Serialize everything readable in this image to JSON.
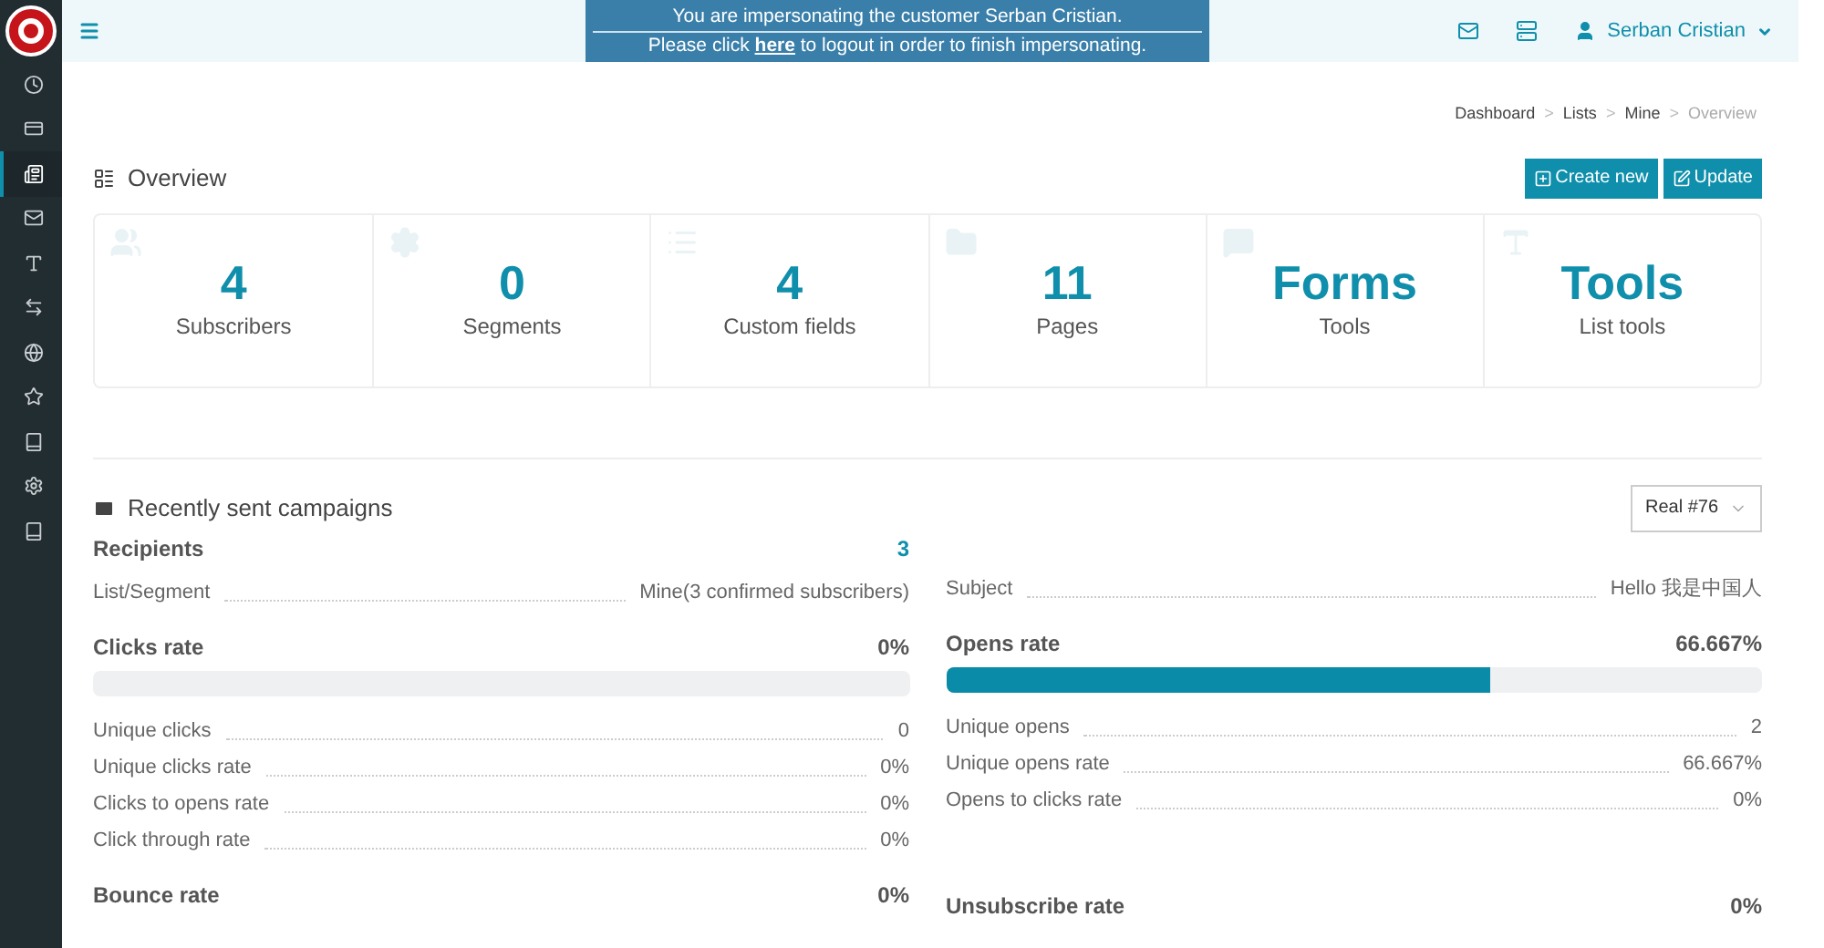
{
  "sidebar": {
    "items": [
      {
        "selected": false
      },
      {
        "selected": false
      },
      {
        "selected": true
      },
      {
        "selected": false
      },
      {
        "selected": false
      },
      {
        "selected": false
      },
      {
        "selected": false
      },
      {
        "selected": false
      },
      {
        "selected": false
      },
      {
        "selected": false
      },
      {
        "selected": false
      }
    ]
  },
  "impersonation": {
    "line1": "You are impersonating the customer Serban Cristian.",
    "before": "Please click ",
    "link": "here",
    "after": " to logout in order to finish impersonating."
  },
  "user": {
    "name": "Serban Cristian"
  },
  "breadcrumb_separator": ">",
  "breadcrumb": [
    {
      "label": "Dashboard",
      "selected": false
    },
    {
      "label": "Lists",
      "selected": false
    },
    {
      "label": "Mine",
      "selected": false
    },
    {
      "label": "Overview",
      "selected": true
    }
  ],
  "overview": {
    "title": "Overview",
    "buttons": [
      {
        "label": "Create new"
      },
      {
        "label": "Update"
      }
    ],
    "cards": [
      {
        "value": "4",
        "label": "Subscribers"
      },
      {
        "value": "0",
        "label": "Segments"
      },
      {
        "value": "4",
        "label": "Custom fields"
      },
      {
        "value": "11",
        "label": "Pages"
      },
      {
        "value": "Forms",
        "label": "Tools"
      },
      {
        "value": "Tools",
        "label": "List tools"
      }
    ]
  },
  "campaigns": {
    "title": "Recently sent campaigns",
    "campaign_select": {
      "value": "Real #76"
    },
    "left": [
      {
        "kind": "count",
        "label": "Recipients",
        "value": "3"
      },
      {
        "kind": "row",
        "label": "List/Segment",
        "value": "Mine(3 confirmed subscribers)"
      },
      {
        "kind": "meter",
        "label": "Clicks rate",
        "value": "0%",
        "level": 0
      },
      {
        "kind": "row",
        "label": "Unique clicks",
        "value": "0"
      },
      {
        "kind": "row",
        "label": "Unique clicks rate",
        "value": "0%"
      },
      {
        "kind": "row",
        "label": "Clicks to opens rate",
        "value": "0%"
      },
      {
        "kind": "row",
        "label": "Click through rate",
        "value": "0%"
      },
      {
        "kind": "heading",
        "label": "Bounce rate",
        "value": "0%"
      }
    ],
    "right": [
      {
        "kind": "row",
        "label": "Subject",
        "value": "Hello 我是中国人"
      },
      {
        "kind": "meter",
        "label": "Opens rate",
        "value": "66.667%",
        "level": 0.667
      },
      {
        "kind": "row",
        "label": "Unique opens",
        "value": "2"
      },
      {
        "kind": "row",
        "label": "Unique opens rate",
        "value": "66.667%"
      },
      {
        "kind": "row",
        "label": "Opens to clicks rate",
        "value": "0%"
      },
      {
        "kind": "gap"
      },
      {
        "kind": "heading",
        "label": "Unsubscribe rate",
        "value": "0%"
      }
    ]
  }
}
